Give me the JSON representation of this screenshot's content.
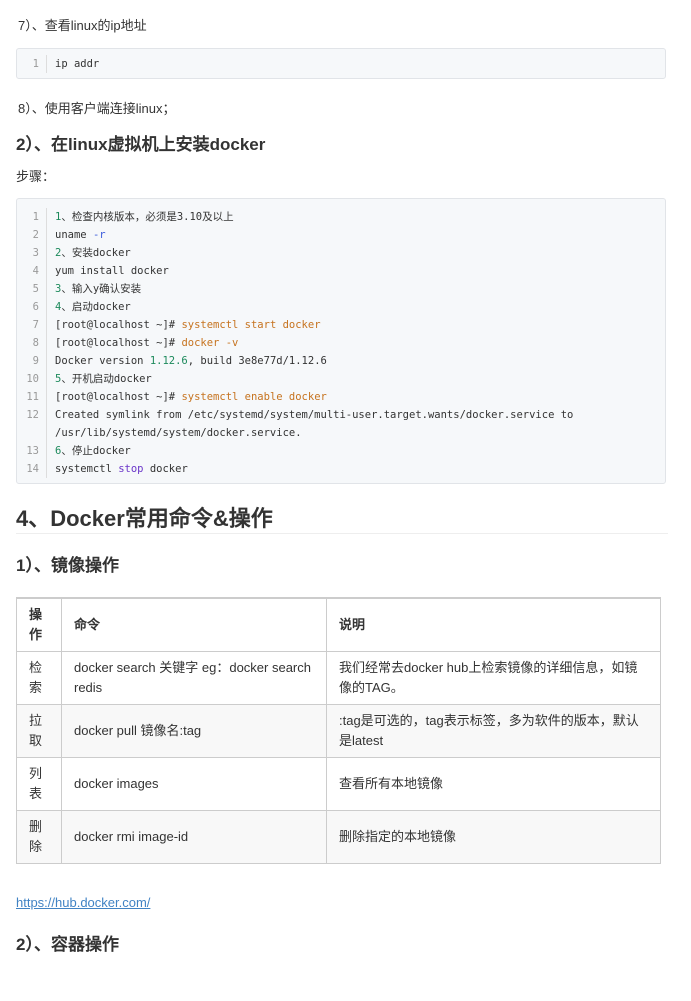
{
  "step7": "7）、查看linux的ip地址",
  "code1": [
    {
      "n": "1",
      "t": "ip addr"
    }
  ],
  "step8": "8）、使用客户端连接linux；",
  "h_install": "2）、在linux虚拟机上安装docker",
  "steps_label": "步骤：",
  "code2": [
    {
      "n": "1",
      "parts": [
        [
          "g",
          "1"
        ],
        [
          "",
          "、检查内核版本，必须是3.10及以上"
        ]
      ]
    },
    {
      "n": "2",
      "parts": [
        [
          "",
          "uname "
        ],
        [
          "b",
          "-r"
        ]
      ]
    },
    {
      "n": "3",
      "parts": [
        [
          "g",
          "2"
        ],
        [
          "",
          "、安装docker"
        ]
      ]
    },
    {
      "n": "4",
      "parts": [
        [
          "",
          "yum install docker"
        ]
      ]
    },
    {
      "n": "5",
      "parts": [
        [
          "g",
          "3"
        ],
        [
          "",
          "、输入y确认安装"
        ]
      ]
    },
    {
      "n": "6",
      "parts": [
        [
          "g",
          "4"
        ],
        [
          "",
          "、启动docker"
        ]
      ]
    },
    {
      "n": "7",
      "parts": [
        [
          "",
          "[root@localhost ~]# "
        ],
        [
          "o",
          "systemctl start docker"
        ]
      ]
    },
    {
      "n": "8",
      "parts": [
        [
          "",
          "[root@localhost ~]# "
        ],
        [
          "o",
          "docker -v"
        ]
      ]
    },
    {
      "n": "9",
      "parts": [
        [
          "",
          "Docker version "
        ],
        [
          "g",
          "1.12.6"
        ],
        [
          "",
          ", build 3e8e77d/1.12.6"
        ]
      ]
    },
    {
      "n": "10",
      "parts": [
        [
          "g",
          "5"
        ],
        [
          "",
          "、开机启动docker"
        ]
      ]
    },
    {
      "n": "11",
      "parts": [
        [
          "",
          "[root@localhost ~]# "
        ],
        [
          "o",
          "systemctl enable docker"
        ]
      ]
    },
    {
      "n": "12",
      "parts": [
        [
          "",
          "Created symlink from /etc/systemd/system/multi-user.target.wants/docker.service to"
        ]
      ]
    },
    {
      "n": "",
      "parts": [
        [
          "",
          "/usr/lib/systemd/system/docker.service."
        ]
      ]
    },
    {
      "n": "13",
      "parts": [
        [
          "g",
          "6"
        ],
        [
          "",
          "、停止docker"
        ]
      ]
    },
    {
      "n": "14",
      "parts": [
        [
          "",
          "systemctl "
        ],
        [
          "p",
          "stop"
        ],
        [
          "",
          " docker"
        ]
      ]
    }
  ],
  "h_commands": "4、Docker常用命令&操作",
  "h_image": "1）、镜像操作",
  "table": {
    "headers": [
      "操作",
      "命令",
      "说明"
    ],
    "rows": [
      [
        "检索",
        "docker  search 关键字  eg：docker search redis",
        "我们经常去docker  hub上检索镜像的详细信息，如镜像的TAG。"
      ],
      [
        "拉取",
        "docker pull 镜像名:tag",
        ":tag是可选的，tag表示标签，多为软件的版本，默认是latest"
      ],
      [
        "列表",
        "docker images",
        "查看所有本地镜像"
      ],
      [
        "删除",
        "docker rmi image-id",
        "删除指定的本地镜像"
      ]
    ]
  },
  "link": "https://hub.docker.com/",
  "h_container": "2）、容器操作"
}
